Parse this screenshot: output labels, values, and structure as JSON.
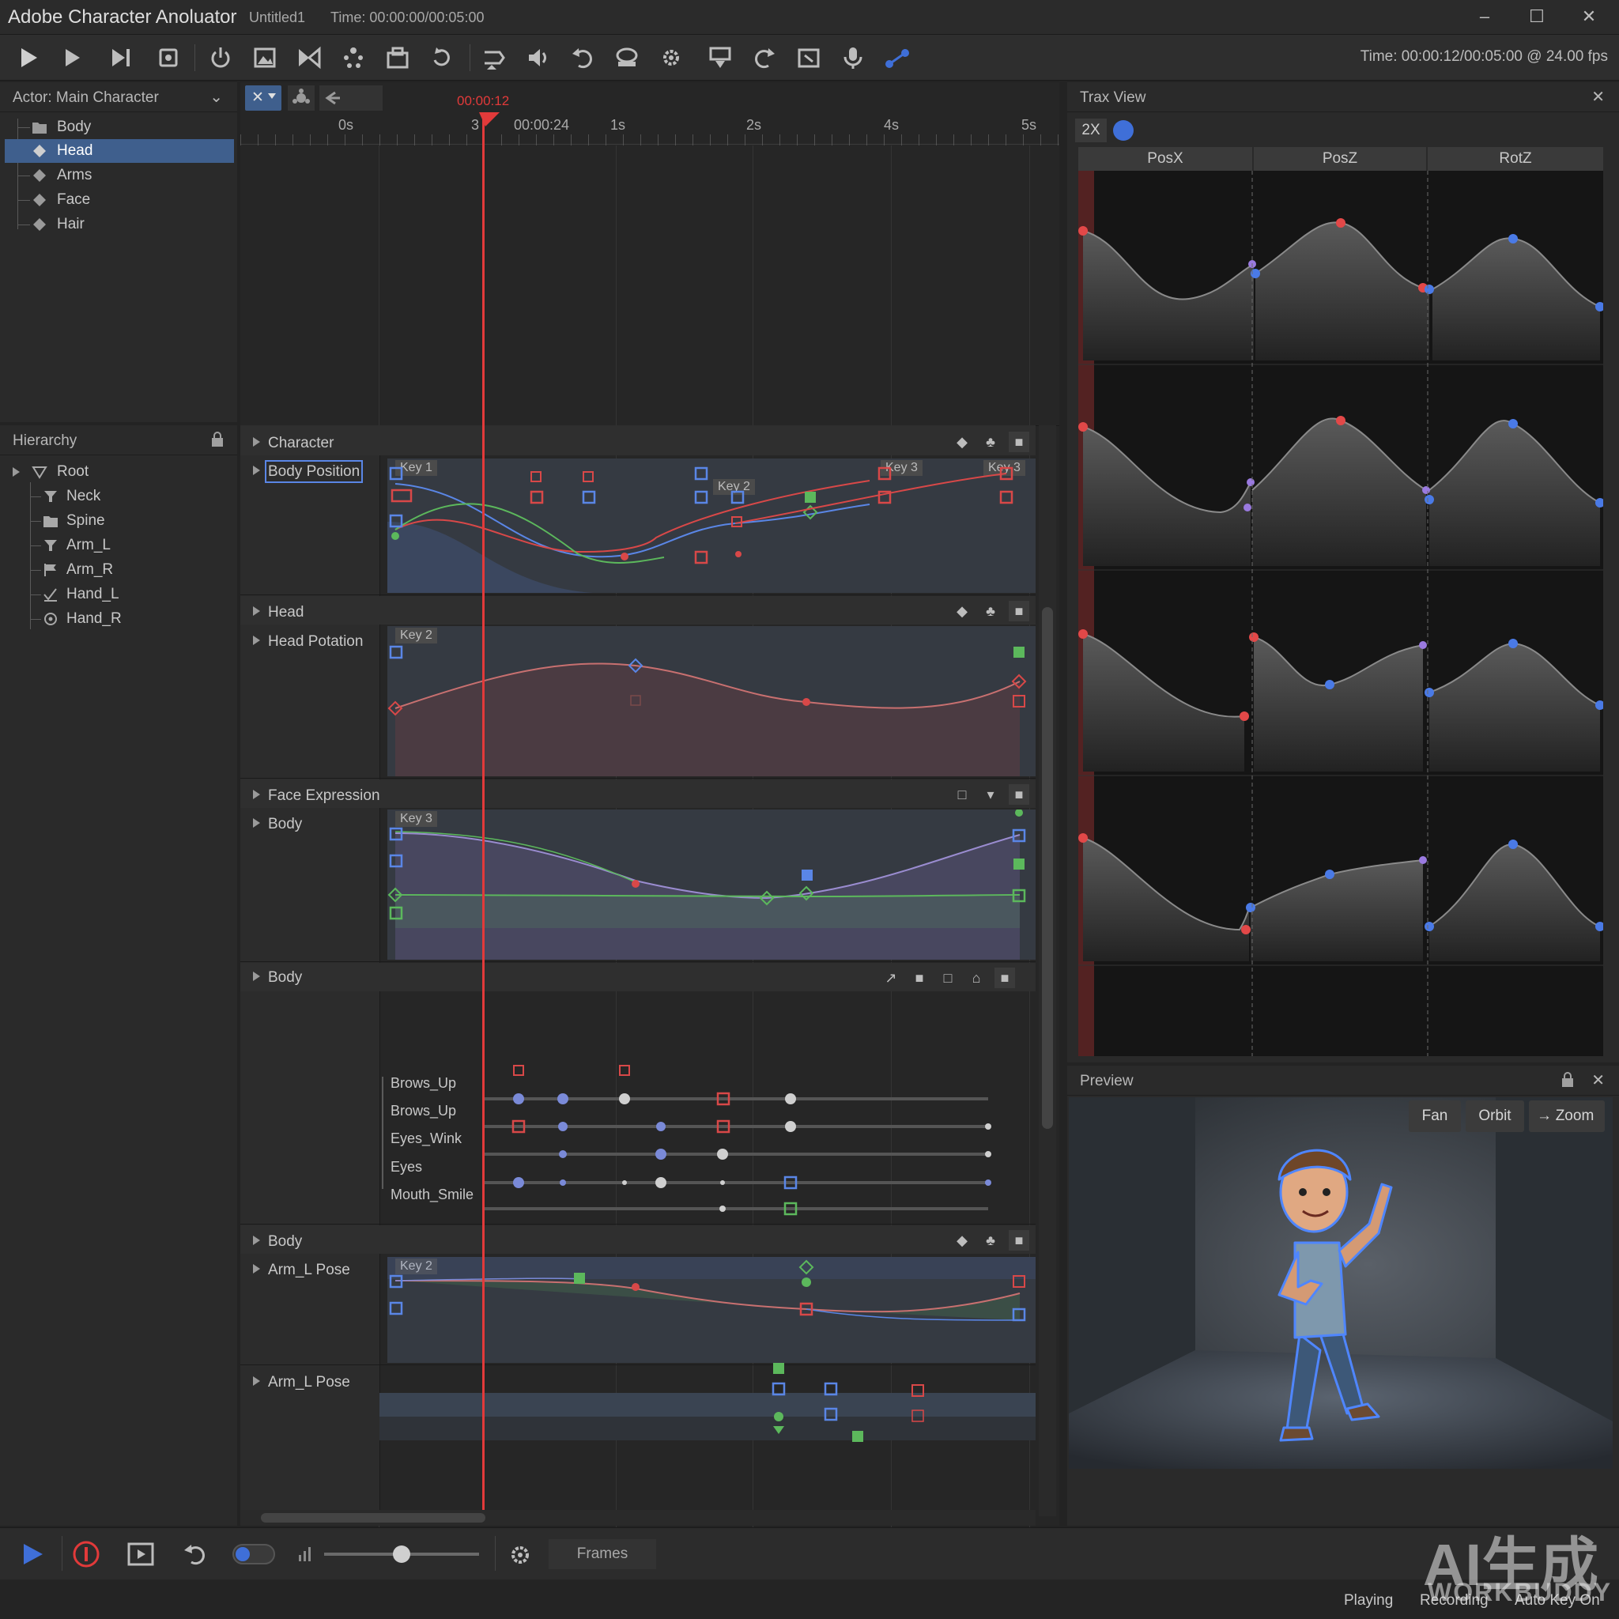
{
  "window": {
    "app_title": "Adobe Character Anoluator",
    "doc_title": "Untitled1",
    "title_time": "Time: 00:00:00/00:05:00"
  },
  "toolbar": {
    "time_readout": "Time: 00:00:12/00:05:00 @ 24.00 fps",
    "icons": [
      "play-icon",
      "play-alt-icon",
      "step-forward-icon",
      "record-stack-icon",
      "power-icon",
      "image-icon",
      "bowtie-icon",
      "puppet-icon",
      "package-icon",
      "loop-icon",
      "import-icon",
      "audio-icon",
      "undo-icon",
      "stamp-icon",
      "gear-icon",
      "export-icon",
      "redo-icon",
      "crop-icon",
      "microphone-icon",
      "link-nodes-icon"
    ]
  },
  "actor_panel": {
    "header": "Actor: Main Character",
    "items": [
      {
        "label": "Body",
        "icon": "folder-icon",
        "selected": false
      },
      {
        "label": "Head",
        "icon": "diamond-icon",
        "selected": true
      },
      {
        "label": "Arms",
        "icon": "diamond-icon",
        "selected": false
      },
      {
        "label": "Face",
        "icon": "diamond-icon",
        "selected": false
      },
      {
        "label": "Hair",
        "icon": "diamond-icon",
        "selected": false
      }
    ]
  },
  "hierarchy_panel": {
    "header": "Hierarchy",
    "items": [
      {
        "label": "Root",
        "icon": "triangle-icon"
      },
      {
        "label": "Neck",
        "icon": "funnel-icon"
      },
      {
        "label": "Spine",
        "icon": "folder-icon"
      },
      {
        "label": "Arm_L",
        "icon": "funnel-icon"
      },
      {
        "label": "Arm_R",
        "icon": "flag-icon"
      },
      {
        "label": "Hand_L",
        "icon": "check-icon"
      },
      {
        "label": "Hand_R",
        "icon": "hand-icon"
      }
    ]
  },
  "timeline": {
    "playhead_time": "00:00:12",
    "ruler": [
      "0s",
      "3",
      "00:00:24",
      "1s",
      "2s",
      "4s",
      "5s"
    ],
    "tracks": {
      "character": {
        "group": "Character",
        "name": "Body Position",
        "keys": [
          "Key 1",
          "Key 2",
          "Key 3",
          "Key 3"
        ]
      },
      "head": {
        "group": "Head",
        "name": "Head Potation",
        "keys": [
          "Key 2"
        ]
      },
      "face": {
        "group": "Face Expression",
        "name": "Body",
        "keys": [
          "Key 3"
        ]
      },
      "body": {
        "group": "Body",
        "subtracks": [
          "Brows_Up",
          "Brows_Up",
          "Eyes_Wink",
          "Eyes",
          "Mouth_Smile"
        ]
      },
      "arm1": {
        "group": "Body",
        "name": "Arm_L Pose",
        "keys": [
          "Key 2"
        ]
      },
      "arm2": {
        "group": "Arm_L Pose"
      }
    }
  },
  "trax": {
    "header": "Trax View",
    "zoom": "2X",
    "columns": [
      "PosX",
      "PosZ",
      "RotZ"
    ]
  },
  "preview": {
    "header": "Preview",
    "buttons": [
      "Fan",
      "Orbit",
      "Zoom"
    ]
  },
  "bottom": {
    "units": "Frames",
    "slider_value": 0.5
  },
  "status": {
    "playing": "Playing",
    "recording": "Recording",
    "autokey": "Auto Key On"
  },
  "watermark": {
    "line1": "AI生成",
    "line2": "WORKBUDDY"
  },
  "colors": {
    "accent": "#3f6fd8",
    "playhead": "#e23a3a",
    "key_red": "#d84848",
    "key_blue": "#5a86e6",
    "key_green": "#5cb85c"
  }
}
